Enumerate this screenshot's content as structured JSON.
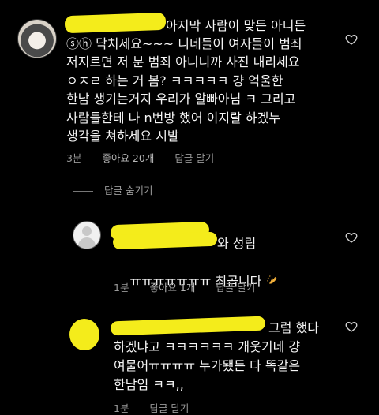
{
  "comment1": {
    "lines": [
      "아지막 사람이 맞든 아니든",
      "ⓢⓗ 닥치세요~~~ 니네들이 여자들이 범죄",
      "저지르면 저 분 범죄 아니니까 사진 내리세요",
      "ㅇㅈㄹ 하는 거 봄? ㅋㅋㅋㅋㅋ 걍 억울한",
      "한남 생기는거지 우리가 알빠아님 ㅋ 그리고",
      "사람들한테 나 n번방 했어 이지랄 하겠누",
      "생각을 쳐하세요 시발"
    ],
    "time": "3분",
    "likes": "좋아요 20개",
    "reply": "답글 달기"
  },
  "hide_replies": "답글 숨기기",
  "reply1": {
    "lines": [
      "와 성림",
      "ㅠㅠㅠㅠㅠㅠㅠ 최곱니다"
    ],
    "time": "1분",
    "likes": "좋아요 1개",
    "reply": "답글 달기"
  },
  "reply2": {
    "lines": [
      "그럼 했다",
      "하겠냐고 ㅋㅋㅋㅋㅋㅋ 개웃기네 걍",
      "여물어ㅠㅠㅠㅠ 누가됐든 다 똑같은",
      "한남임 ㅋㅋ,,"
    ],
    "time": "1분",
    "reply": "답글 달기"
  },
  "icons": {
    "like": "heart-outline-icon",
    "clap": "clapping-hands-emoji"
  },
  "colors": {
    "background": "#000000",
    "text": "#f5f5f5",
    "meta": "#9a9a9a",
    "redaction": "#f4ec1b"
  }
}
